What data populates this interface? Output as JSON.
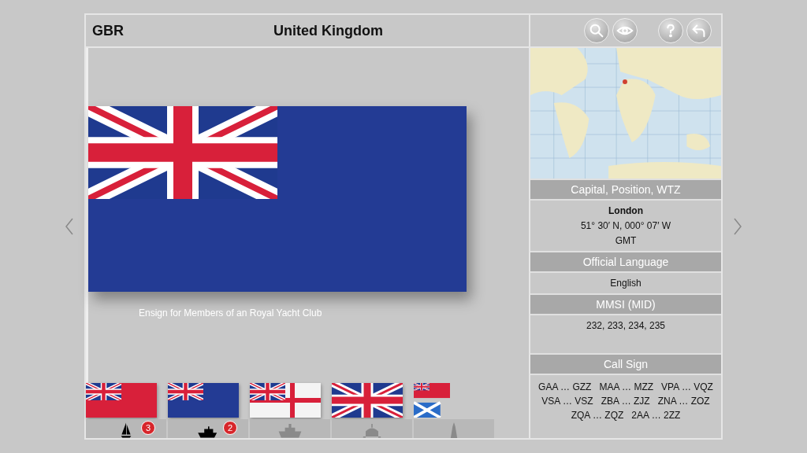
{
  "header": {
    "code": "GBR",
    "title": "United Kingdom"
  },
  "toolbar": [
    {
      "kind": "search"
    },
    {
      "kind": "eye"
    },
    {
      "kind": "help"
    },
    {
      "kind": "back"
    }
  ],
  "main_flag": {
    "kind": "blue_ensign",
    "caption": "Ensign for Members of an Royal Yacht Club"
  },
  "thumbnails": [
    {
      "flag": {
        "kind": "red_ensign"
      },
      "vessel": {
        "kind": "sailboat"
      },
      "disabled": false,
      "badge": "3"
    },
    {
      "flag": {
        "kind": "blue_ensign"
      },
      "vessel": {
        "kind": "police_boat"
      },
      "disabled": false,
      "badge": "2"
    },
    {
      "flag": {
        "kind": "white_ensign"
      },
      "vessel": {
        "kind": "warship"
      },
      "disabled": true
    },
    {
      "flag": {
        "kind": "union"
      },
      "vessel": {
        "kind": "building"
      },
      "disabled": true
    },
    {
      "flag": {
        "kind": "red_scot"
      },
      "vessel": {
        "kind": "tower"
      },
      "disabled": true
    }
  ],
  "info": {
    "capital_heading": "Capital, Position, WTZ",
    "capital": "London",
    "position": "51° 30′ N, 000° 07′ W",
    "timezone": "GMT",
    "language_heading": "Official Language",
    "language": "English",
    "mmsi_heading": "MMSI (MID)",
    "mmsi": "232, 233, 234, 235",
    "callsign_heading": "Call Sign",
    "callsigns": [
      "GAA … GZZ",
      "MAA … MZZ",
      "VPA … VQZ",
      "VSA … VSZ",
      "ZBA … ZJZ",
      "ZNA … ZOZ",
      "ZQA … ZQZ",
      "2AA … 2ZZ"
    ]
  }
}
